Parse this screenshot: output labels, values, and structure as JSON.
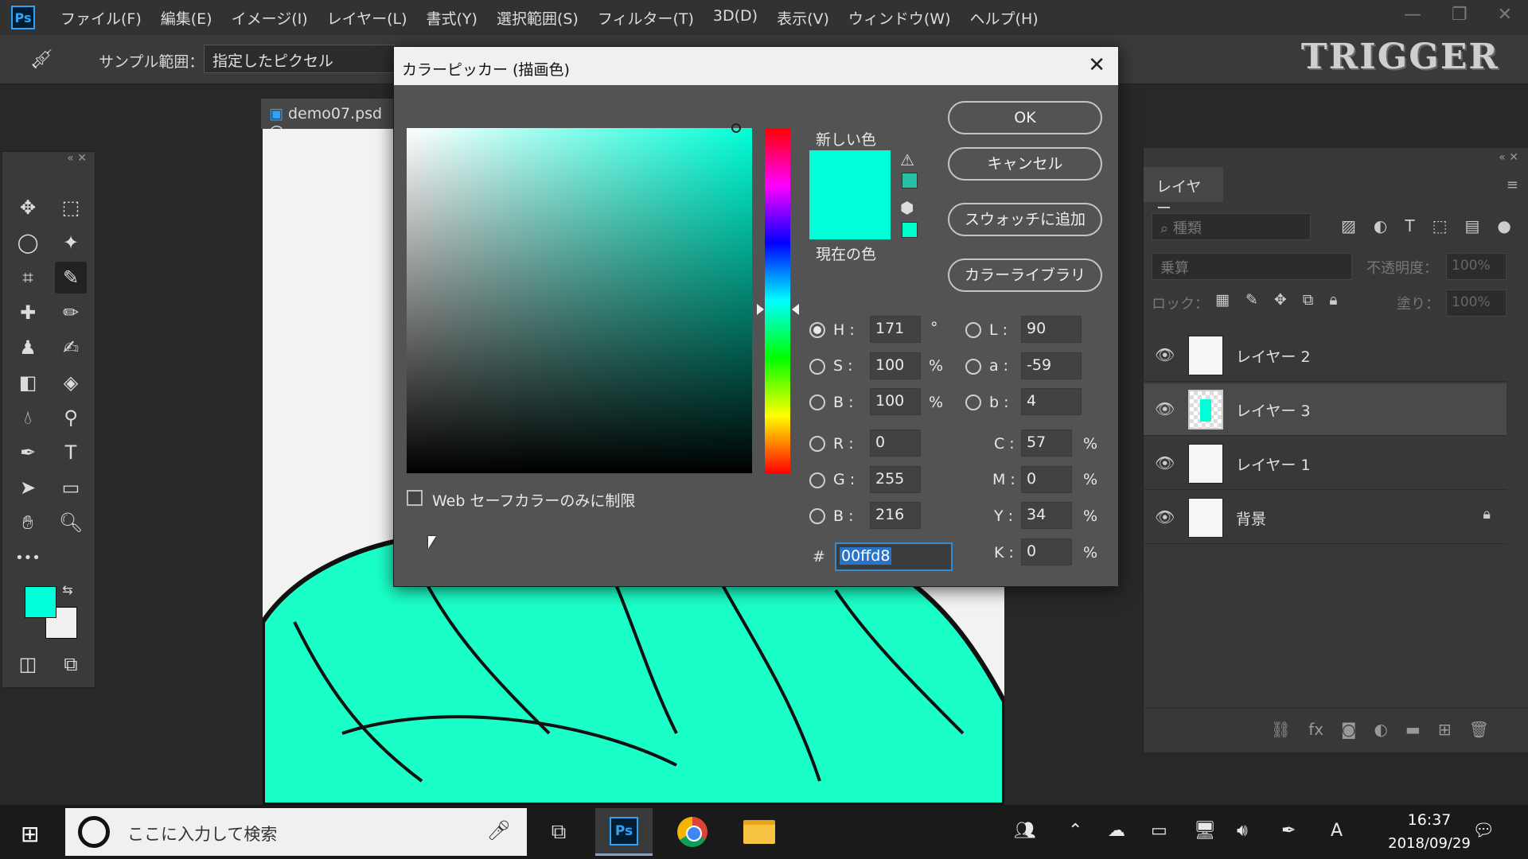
{
  "app": {
    "logo": "Ps",
    "trigger_logo": "TRIGGER"
  },
  "menu": [
    "ファイル(F)",
    "編集(E)",
    "イメージ(I)",
    "レイヤー(L)",
    "書式(Y)",
    "選択範囲(S)",
    "フィルター(T)",
    "3D(D)",
    "表示(V)",
    "ウィンドウ(W)",
    "ヘルプ(H)"
  ],
  "window_controls": {
    "minimize": "—",
    "restore": "❐",
    "close": "✕"
  },
  "options": {
    "sample_label": "サンプル範囲：",
    "sample_value": "指定したピクセル",
    "tool_icon": "eyedropper-icon"
  },
  "document": {
    "tab": "demo07.psd @"
  },
  "tools": {
    "more": "•••"
  },
  "colors": {
    "foreground": "#00ffd8",
    "background": "#f0f0f0",
    "accent": "#2fa3f7"
  },
  "picker": {
    "title": "カラーピッカー (描画色)",
    "close": "✕",
    "new_label": "新しい色",
    "current_label": "現在の色",
    "buttons": {
      "ok": "OK",
      "cancel": "キャンセル",
      "add_swatch": "スウォッチに追加",
      "library": "カラーライブラリ"
    },
    "hsb": {
      "h_label": "H :",
      "h": "171",
      "h_unit": "°",
      "s_label": "S :",
      "s": "100",
      "s_unit": "%",
      "b_label": "B :",
      "b": "100",
      "b_unit": "%"
    },
    "rgb": {
      "r_label": "R :",
      "r": "0",
      "g_label": "G :",
      "g": "255",
      "b_label": "B :",
      "b": "216"
    },
    "lab": {
      "l_label": "L :",
      "l": "90",
      "a_label": "a :",
      "a": "-59",
      "b_label": "b :",
      "b": "4"
    },
    "cmyk": {
      "c_label": "C :",
      "c": "57",
      "m_label": "M :",
      "m": "0",
      "y_label": "Y :",
      "y": "34",
      "k_label": "K :",
      "k": "0",
      "unit": "%"
    },
    "hex_label": "#",
    "hex": "00ffd8",
    "websafe_label": "Web セーフカラーのみに制限",
    "hue_deg": 171,
    "selected_mode": "H"
  },
  "layers": {
    "tab": "レイヤー",
    "search_placeholder": "種類",
    "blend_mode": "乗算",
    "opacity_label": "不透明度：",
    "opacity": "100%",
    "lock_label": "ロック：",
    "fill_label": "塗り：",
    "fill": "100%",
    "items": [
      {
        "name": "レイヤー 2",
        "active": false,
        "locked": false
      },
      {
        "name": "レイヤー 3",
        "active": true,
        "locked": false
      },
      {
        "name": "レイヤー 1",
        "active": false,
        "locked": false
      },
      {
        "name": "背景",
        "active": false,
        "locked": true
      }
    ]
  },
  "taskbar": {
    "search_text": "ここに入力して検索",
    "time": "16:37",
    "date": "2018/09/29",
    "ps_icon": "Ps",
    "ime": "A"
  }
}
